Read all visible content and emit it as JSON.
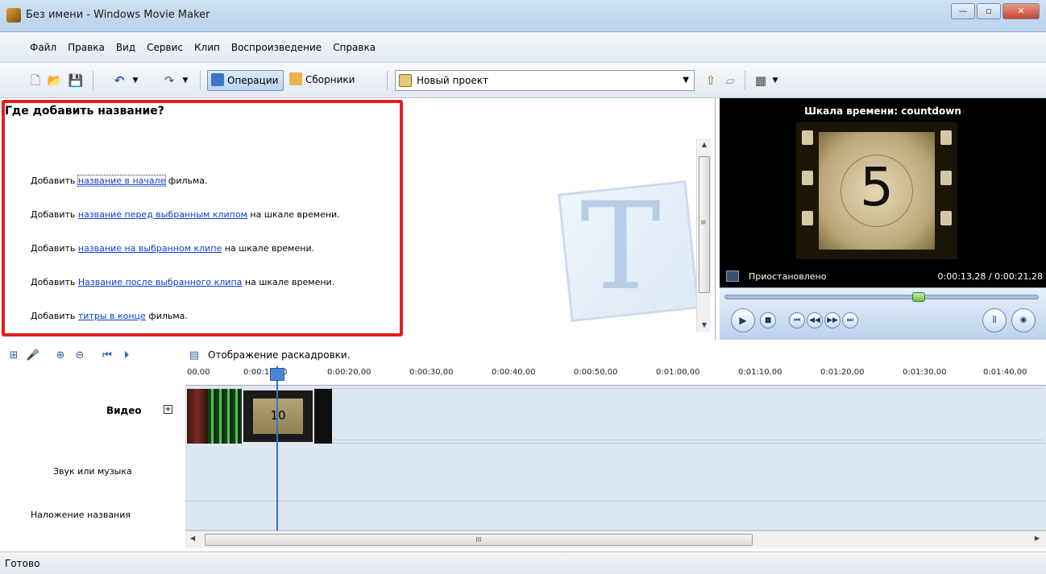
{
  "window": {
    "title": "Без имени - Windows Movie Maker"
  },
  "menu": [
    "Файл",
    "Правка",
    "Вид",
    "Сервис",
    "Клип",
    "Воспроизведение",
    "Справка"
  ],
  "toolbar": {
    "operations_label": "Операции",
    "collections_label": "Сборники",
    "project_combo_value": "Новый проект"
  },
  "task_pane": {
    "heading": "Где добавить название?",
    "options": [
      {
        "prefix": "Добавить ",
        "link": "название в начале",
        "suffix": " фильма."
      },
      {
        "prefix": "Добавить ",
        "link": "название перед выбранным клипом",
        "suffix": " на шкале времени."
      },
      {
        "prefix": "Добавить ",
        "link": "название на выбранном клипе",
        "suffix": " на шкале времени."
      },
      {
        "prefix": "Добавить ",
        "link": "Название после выбранного клипа",
        "suffix": " на шкале времени."
      },
      {
        "prefix": "Добавить ",
        "link": "титры в конце",
        "suffix": " фильма."
      }
    ]
  },
  "monitor": {
    "title": "Шкала времени: countdown",
    "frame_number": "5",
    "status": "Приостановлено",
    "time": "0:00:13,28 / 0:00:21,28",
    "seek_position": 0.62
  },
  "timeline_toolbar": {
    "storyboard_label": "Отображение раскадровки."
  },
  "timeline": {
    "ruler_ticks": [
      "00,00",
      "0:00:10,00",
      "0:00:20,00",
      "0:00:30,00",
      "0:00:40,00",
      "0:00:50,00",
      "0:01:00,00",
      "0:01:10,00",
      "0:01:20,00",
      "0:01:30,00",
      "0:01:40,00"
    ],
    "tracks": {
      "video": "Видео",
      "audio": "Звук или музыка",
      "overlay": "Наложение названия"
    },
    "clip_label": "10"
  },
  "status_bar": {
    "text": "Готово"
  },
  "icons": {
    "new": "new-file-icon",
    "open": "open-folder-icon",
    "save": "save-icon",
    "undo": "undo-icon",
    "redo": "redo-icon"
  }
}
